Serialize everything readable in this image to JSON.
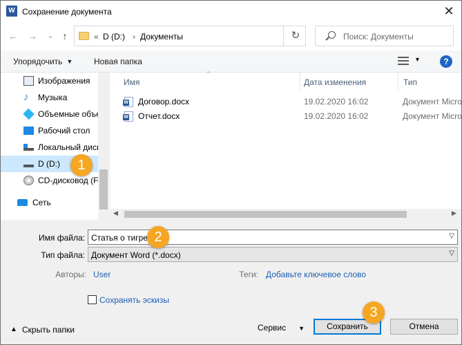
{
  "window": {
    "title": "Сохранение документа",
    "close_glyph": "✕"
  },
  "nav": {
    "back_glyph": "←",
    "forward_glyph": "→",
    "recent_glyph": "⌄",
    "up_glyph": "↑",
    "breadcrumb_prefix": "«",
    "breadcrumb": [
      "D (D:)",
      "Документы"
    ],
    "breadcrumb_sep": "›",
    "refresh_glyph": "↻",
    "search_placeholder": "Поиск: Документы"
  },
  "toolbar": {
    "organize_label": "Упорядочить",
    "new_folder_label": "Новая папка",
    "help_label": "?"
  },
  "sidebar": {
    "items": [
      {
        "label": "Изображения",
        "icon": "pictures-icon"
      },
      {
        "label": "Музыка",
        "icon": "music-icon"
      },
      {
        "label": "Объемные объекты",
        "icon": "3d-objects-icon"
      },
      {
        "label": "Рабочий стол",
        "icon": "desktop-icon"
      },
      {
        "label": "Локальный диск",
        "icon": "local-disk-icon"
      },
      {
        "label": "D (D:)",
        "icon": "drive-icon",
        "selected": true
      },
      {
        "label": "CD-дисковод (F:)",
        "icon": "cd-drive-icon"
      },
      {
        "label": "Сеть",
        "icon": "network-icon"
      }
    ]
  },
  "files": {
    "columns": {
      "name": "Имя",
      "date": "Дата изменения",
      "type": "Тип"
    },
    "rows": [
      {
        "name": "Договор.docx",
        "date": "19.02.2020 16:02",
        "type": "Документ Microsoft Word"
      },
      {
        "name": "Отчет.docx",
        "date": "19.02.2020 16:02",
        "type": "Документ Microsoft Word"
      }
    ]
  },
  "form": {
    "filename_label": "Имя файла:",
    "filename_value": "Статья о тигре",
    "filetype_label": "Тип файла:",
    "filetype_value": "Документ Word (*.docx)",
    "authors_label": "Авторы:",
    "authors_value": "User",
    "tags_label": "Теги:",
    "tags_value": "Добавьте ключевое слово",
    "thumbnails_label": "Сохранять эскизы",
    "thumbnails_checked": false
  },
  "footer": {
    "hide_folders_label": "Скрыть папки",
    "service_label": "Сервис",
    "save_label": "Сохранить",
    "cancel_label": "Отмена"
  },
  "callouts": [
    "1",
    "2",
    "3"
  ],
  "colors": {
    "accent": "#0078d7",
    "callout": "#f5a623",
    "link": "#1a5fb4",
    "selection": "#cce8ff"
  }
}
